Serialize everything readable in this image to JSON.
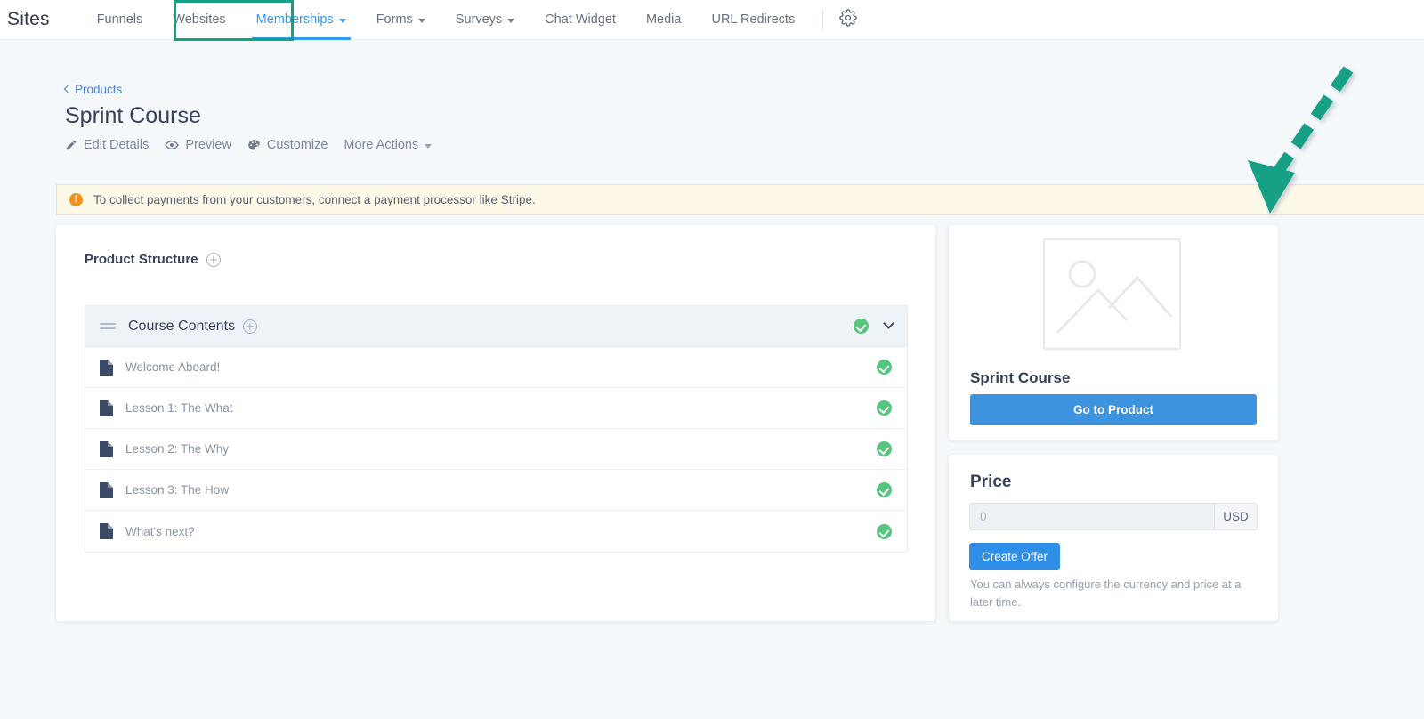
{
  "nav": {
    "brand": "Sites",
    "items": [
      {
        "label": "Funnels",
        "has_caret": false,
        "active": false
      },
      {
        "label": "Websites",
        "has_caret": false,
        "active": false
      },
      {
        "label": "Memberships",
        "has_caret": true,
        "active": true
      },
      {
        "label": "Forms",
        "has_caret": true,
        "active": false
      },
      {
        "label": "Surveys",
        "has_caret": true,
        "active": false
      },
      {
        "label": "Chat Widget",
        "has_caret": false,
        "active": false
      },
      {
        "label": "Media",
        "has_caret": false,
        "active": false
      },
      {
        "label": "URL Redirects",
        "has_caret": false,
        "active": false
      }
    ],
    "settings_icon": "gear-icon",
    "highlight_color": "#13a085",
    "active_color": "#2e9bf0"
  },
  "header": {
    "breadcrumb": "Products",
    "title": "Sprint Course",
    "actions": [
      {
        "label": "Edit Details",
        "icon": "pencil-icon"
      },
      {
        "label": "Preview",
        "icon": "eye-icon"
      },
      {
        "label": "Customize",
        "icon": "palette-icon"
      },
      {
        "label": "More Actions",
        "icon": "chevron-down-icon"
      }
    ]
  },
  "banner": {
    "icon": "exclamation-icon",
    "text": "To collect payments from your customers, connect a payment processor like Stripe.",
    "background": "#fdf8e7",
    "icon_color": "#f0921f"
  },
  "product_structure": {
    "title": "Product Structure",
    "add_icon": "plus-circle-icon",
    "section": {
      "title": "Course Contents",
      "add_icon": "plus-circle-icon",
      "drag_icon": "drag-handle-icon",
      "status_icon": "check-circle-icon",
      "collapse_icon": "chevron-down-icon"
    },
    "lessons": [
      {
        "label": "Welcome Aboard!",
        "icon": "document-icon",
        "status": "check-circle-icon"
      },
      {
        "label": "Lesson 1: The What",
        "icon": "document-icon",
        "status": "check-circle-icon"
      },
      {
        "label": "Lesson 2: The Why",
        "icon": "document-icon",
        "status": "check-circle-icon"
      },
      {
        "label": "Lesson 3: The How",
        "icon": "document-icon",
        "status": "check-circle-icon"
      },
      {
        "label": "What's next?",
        "icon": "document-icon",
        "status": "check-circle-icon"
      }
    ]
  },
  "product_card": {
    "thumbnail_icon": "image-placeholder-icon",
    "name": "Sprint Course",
    "button_label": "Go to Product",
    "button_color": "#3d93dd"
  },
  "price_card": {
    "title": "Price",
    "input_placeholder": "0",
    "input_value": "",
    "currency": "USD",
    "button_label": "Create Offer",
    "button_color": "#2f8ee8",
    "note": "You can always configure the currency and price at a later time."
  },
  "annotation": {
    "type": "dashed-arrow",
    "color": "#12a085",
    "points_to": "warning-banner"
  }
}
